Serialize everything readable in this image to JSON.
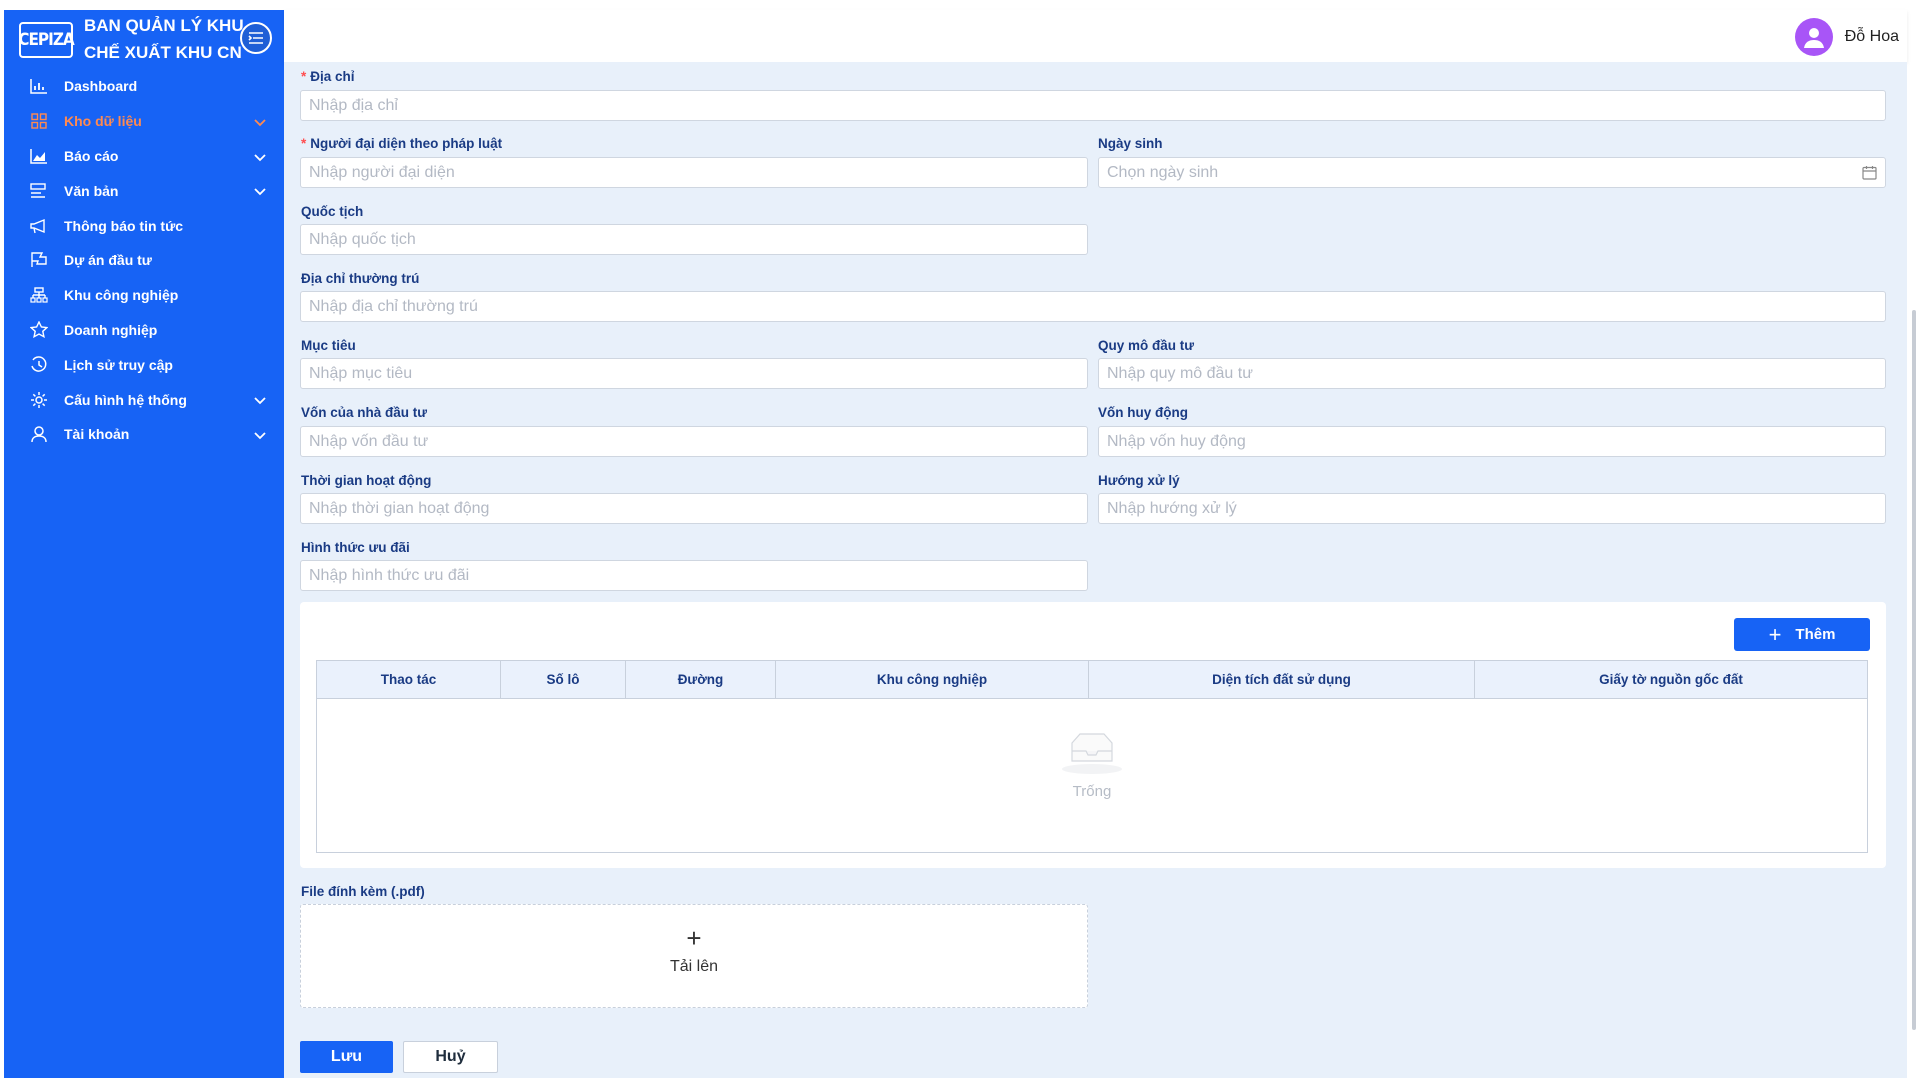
{
  "sidebar": {
    "logo": "CEPIZA",
    "title": "BAN QUẢN LÝ KHU CHẾ XUẤT KHU CN",
    "items": [
      {
        "label": "Dashboard",
        "icon": "bar-chart-icon",
        "expandable": false
      },
      {
        "label": "Kho dữ liệu",
        "icon": "grid-icon",
        "expandable": true,
        "active": true
      },
      {
        "label": "Báo cáo",
        "icon": "area-chart-icon",
        "expandable": true
      },
      {
        "label": "Văn bản",
        "icon": "document-icon",
        "expandable": true
      },
      {
        "label": "Thông báo tin tức",
        "icon": "megaphone-icon",
        "expandable": false
      },
      {
        "label": "Dự án đầu tư",
        "icon": "flag-icon",
        "expandable": false
      },
      {
        "label": "Khu công nghiệp",
        "icon": "cluster-icon",
        "expandable": false
      },
      {
        "label": "Doanh nghiệp",
        "icon": "star-icon",
        "expandable": false
      },
      {
        "label": "Lịch sử truy cập",
        "icon": "history-icon",
        "expandable": false
      },
      {
        "label": "Cấu hình hệ thống",
        "icon": "gear-icon",
        "expandable": true
      },
      {
        "label": "Tài khoản",
        "icon": "user-icon",
        "expandable": true
      }
    ],
    "active_color": "#ff8a50",
    "bg_color": "#1763f5"
  },
  "header": {
    "user_name": "Đỗ Hoa",
    "avatar_color": "#a855f7"
  },
  "form": {
    "address": {
      "label": "Địa chỉ",
      "required": true,
      "placeholder": "Nhập địa chỉ"
    },
    "legal_rep": {
      "label": "Người đại diện theo pháp luật",
      "required": true,
      "placeholder": "Nhập người đại diện"
    },
    "birth_date": {
      "label": "Ngày sinh",
      "placeholder": "Chọn ngày sinh"
    },
    "nationality": {
      "label": "Quốc tịch",
      "placeholder": "Nhập quốc tịch"
    },
    "permanent_address": {
      "label": "Địa chỉ thường trú",
      "placeholder": "Nhập địa chỉ thường trú"
    },
    "objective": {
      "label": "Mục tiêu",
      "placeholder": "Nhập mục tiêu"
    },
    "investment_scale": {
      "label": "Quy mô đầu tư",
      "placeholder": "Nhập quy mô đầu tư"
    },
    "investor_capital": {
      "label": "Vốn của nhà đầu tư",
      "placeholder": "Nhập vốn đầu tư"
    },
    "mobilized_capital": {
      "label": "Vốn huy động",
      "placeholder": "Nhập vốn huy động"
    },
    "operation_time": {
      "label": "Thời gian hoạt động",
      "placeholder": "Nhập thời gian hoạt động"
    },
    "handling_direction": {
      "label": "Hướng xử lý",
      "placeholder": "Nhập hướng xử lý"
    },
    "incentive_form": {
      "label": "Hình thức ưu đãi",
      "placeholder": "Nhập hình thức ưu đãi"
    }
  },
  "land_table": {
    "add_label": "Thêm",
    "columns": [
      "Thao tác",
      "Số lô",
      "Đường",
      "Khu công nghiệp",
      "Diện tích đất sử dụng",
      "Giấy tờ nguồn gốc đất"
    ],
    "rows": [],
    "empty_text": "Trống"
  },
  "attachment": {
    "label": "File đính kèm (.pdf)",
    "upload_label": "Tải lên"
  },
  "actions": {
    "save_label": "Lưu",
    "cancel_label": "Huỷ"
  }
}
